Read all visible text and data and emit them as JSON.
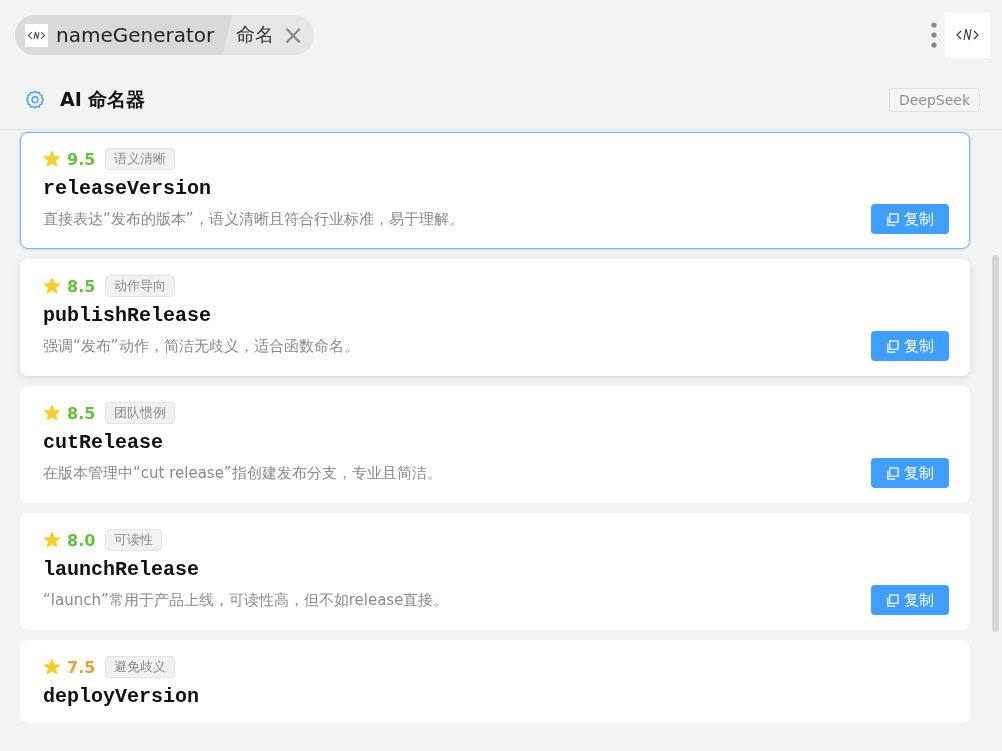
{
  "breadcrumb": {
    "app": "nameGenerator",
    "page": "命名",
    "close": "×"
  },
  "header": {
    "title": "AI 命名器",
    "model": "DeepSeek"
  },
  "results": [
    {
      "score": "9.5",
      "color": "#67c23a",
      "tag": "语义清晰",
      "name": "releaseVersion",
      "description": "直接表达“发布的版本”，语义清晰且符合行业标准，易于理解。",
      "copy": "复制",
      "selected": true
    },
    {
      "score": "8.5",
      "color": "#67c23a",
      "tag": "动作导向",
      "name": "publishRelease",
      "description": "强调“发布”动作，简洁无歧义，适合函数命名。",
      "copy": "复制",
      "selected": false
    },
    {
      "score": "8.5",
      "color": "#67c23a",
      "tag": "团队惯例",
      "name": "cutRelease",
      "description": "在版本管理中“cut release”指创建发布分支，专业且简洁。",
      "copy": "复制",
      "selected": false
    },
    {
      "score": "8.0",
      "color": "#67c23a",
      "tag": "可读性",
      "name": "launchRelease",
      "description": "“launch”常用于产品上线，可读性高，但不如release直接。",
      "copy": "复制",
      "selected": false
    },
    {
      "score": "7.5",
      "color": "#e6a23c",
      "tag": "避免歧义",
      "name": "deployVersion",
      "selected": false
    }
  ]
}
